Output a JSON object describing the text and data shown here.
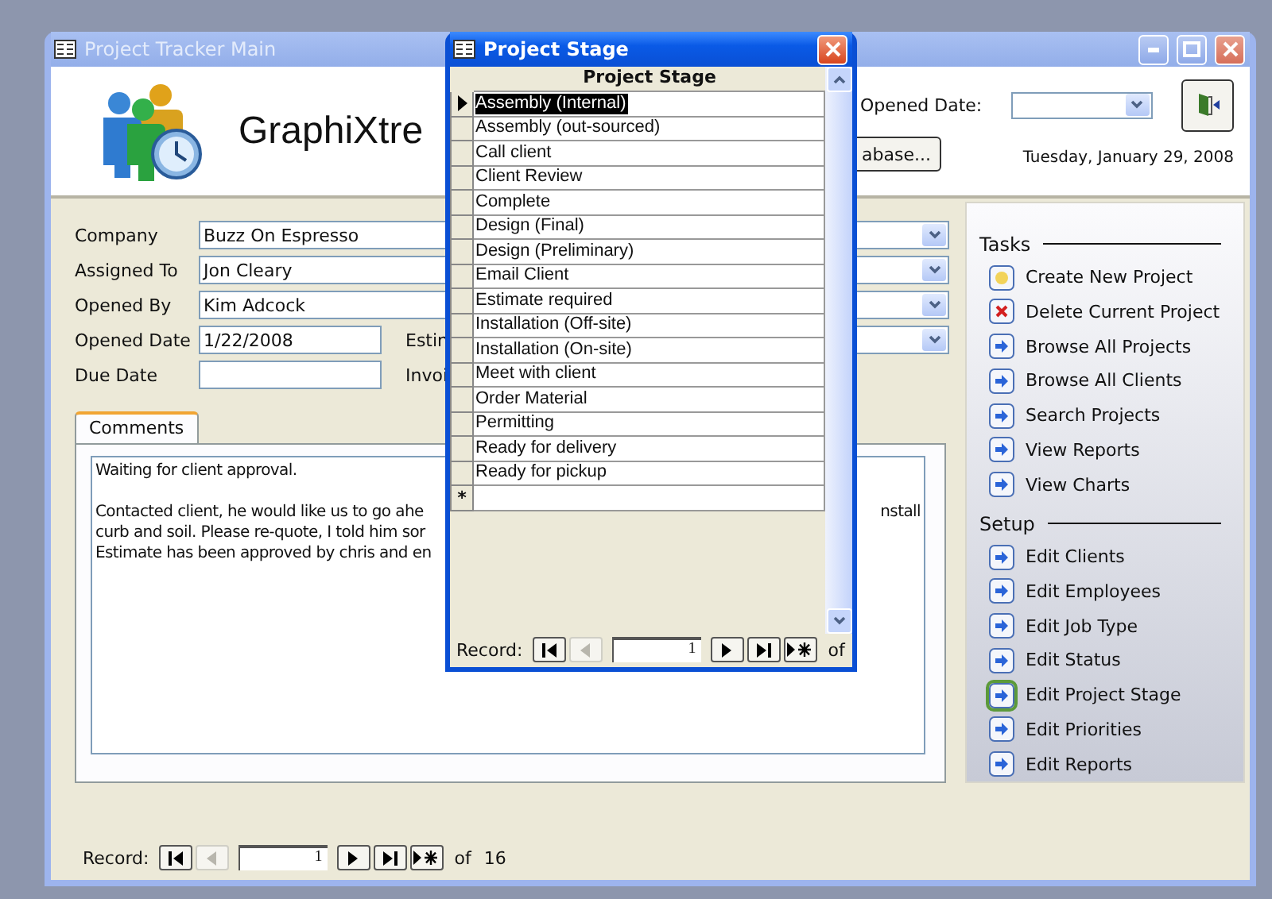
{
  "main_window": {
    "title": "Project Tracker Main"
  },
  "header": {
    "app_title": "GraphiXtre",
    "opened_date_label": "Opened Date:",
    "database_button": "abase...",
    "date": "Tuesday, January 29, 2008"
  },
  "form": {
    "rows": [
      {
        "label": "Company",
        "value": "Buzz On Espresso",
        "kind": "combo"
      },
      {
        "label": "Assigned To",
        "value": "Jon Cleary",
        "kind": "combo"
      },
      {
        "label": "Opened By",
        "value": "Kim Adcock",
        "kind": "combo"
      },
      {
        "label": "Opened Date",
        "value": "1/22/2008",
        "kind": "date_combo",
        "side_label": "Estin"
      },
      {
        "label": "Due Date",
        "kind": "date",
        "side_label": "Invoi"
      }
    ]
  },
  "tabs": [
    {
      "label": "Comments",
      "selected": true
    }
  ],
  "comments": {
    "paragraphs": [
      {
        "lines": [
          {
            "left": "Waiting for client approval."
          }
        ]
      },
      {
        "lines": [
          {
            "left": "Contacted client, he would like us to go ahe",
            "right": "nstall"
          },
          {
            "left": "curb and soil. Please re-quote, I told him sor"
          },
          {
            "left": "Estimate has been approved by chris and en"
          }
        ]
      }
    ]
  },
  "record_nav": {
    "label": "Record:",
    "current": "1",
    "of": "of",
    "total": "16",
    "buttons": [
      {
        "kind": "first",
        "disabled": false
      },
      {
        "kind": "previous",
        "disabled": true
      },
      {
        "kind": "next",
        "disabled": false
      },
      {
        "kind": "last",
        "disabled": false
      },
      {
        "kind": "new",
        "disabled": false
      }
    ]
  },
  "task_pane": {
    "sections": [
      {
        "title": "Tasks",
        "items": [
          {
            "label": "Create New Project",
            "kind": "new",
            "selected": false
          },
          {
            "label": "Delete Current Project",
            "kind": "delete",
            "selected": false
          },
          {
            "label": "Browse All Projects",
            "kind": "arrow",
            "selected": false
          },
          {
            "label": "Browse All Clients",
            "kind": "arrow",
            "selected": false
          },
          {
            "label": "Search Projects",
            "kind": "arrow",
            "selected": false
          },
          {
            "label": "View Reports",
            "kind": "arrow",
            "selected": false
          },
          {
            "label": "View Charts",
            "kind": "arrow",
            "selected": false
          }
        ]
      },
      {
        "title": "Setup",
        "items": [
          {
            "label": "Edit Clients",
            "kind": "arrow",
            "selected": false
          },
          {
            "label": "Edit Employees",
            "kind": "arrow",
            "selected": false
          },
          {
            "label": "Edit Job Type",
            "kind": "arrow",
            "selected": false
          },
          {
            "label": "Edit Status",
            "kind": "arrow",
            "selected": false
          },
          {
            "label": "Edit Project Stage",
            "kind": "arrow",
            "selected": true
          },
          {
            "label": "Edit Priorities",
            "kind": "arrow",
            "selected": false
          },
          {
            "label": "Edit Reports",
            "kind": "arrow",
            "selected": false
          }
        ]
      }
    ]
  },
  "popup": {
    "title": "Project Stage",
    "column": "Project Stage",
    "rows": [
      {
        "label": "Assembly (Internal)",
        "selected": true
      },
      {
        "label": "Assembly (out-sourced)",
        "selected": false
      },
      {
        "label": "Call client",
        "selected": false
      },
      {
        "label": "Client Review",
        "selected": false
      },
      {
        "label": "Complete",
        "selected": false
      },
      {
        "label": "Design (Final)",
        "selected": false
      },
      {
        "label": "Design (Preliminary)",
        "selected": false
      },
      {
        "label": "Email Client",
        "selected": false
      },
      {
        "label": "Estimate required",
        "selected": false
      },
      {
        "label": "Installation (Off-site)",
        "selected": false
      },
      {
        "label": "Installation (On-site)",
        "selected": false
      },
      {
        "label": "Meet with client",
        "selected": false
      },
      {
        "label": "Order Material",
        "selected": false
      },
      {
        "label": "Permitting",
        "selected": false
      },
      {
        "label": "Ready for delivery",
        "selected": false
      },
      {
        "label": "Ready for pickup",
        "selected": false
      }
    ],
    "new_row_marker": "*",
    "record_nav": {
      "label": "Record:",
      "current": "1",
      "of": "of",
      "buttons": [
        {
          "kind": "first",
          "disabled": false
        },
        {
          "kind": "previous",
          "disabled": true
        },
        {
          "kind": "next",
          "disabled": false
        },
        {
          "kind": "last",
          "disabled": false
        },
        {
          "kind": "new",
          "disabled": false
        }
      ]
    }
  }
}
